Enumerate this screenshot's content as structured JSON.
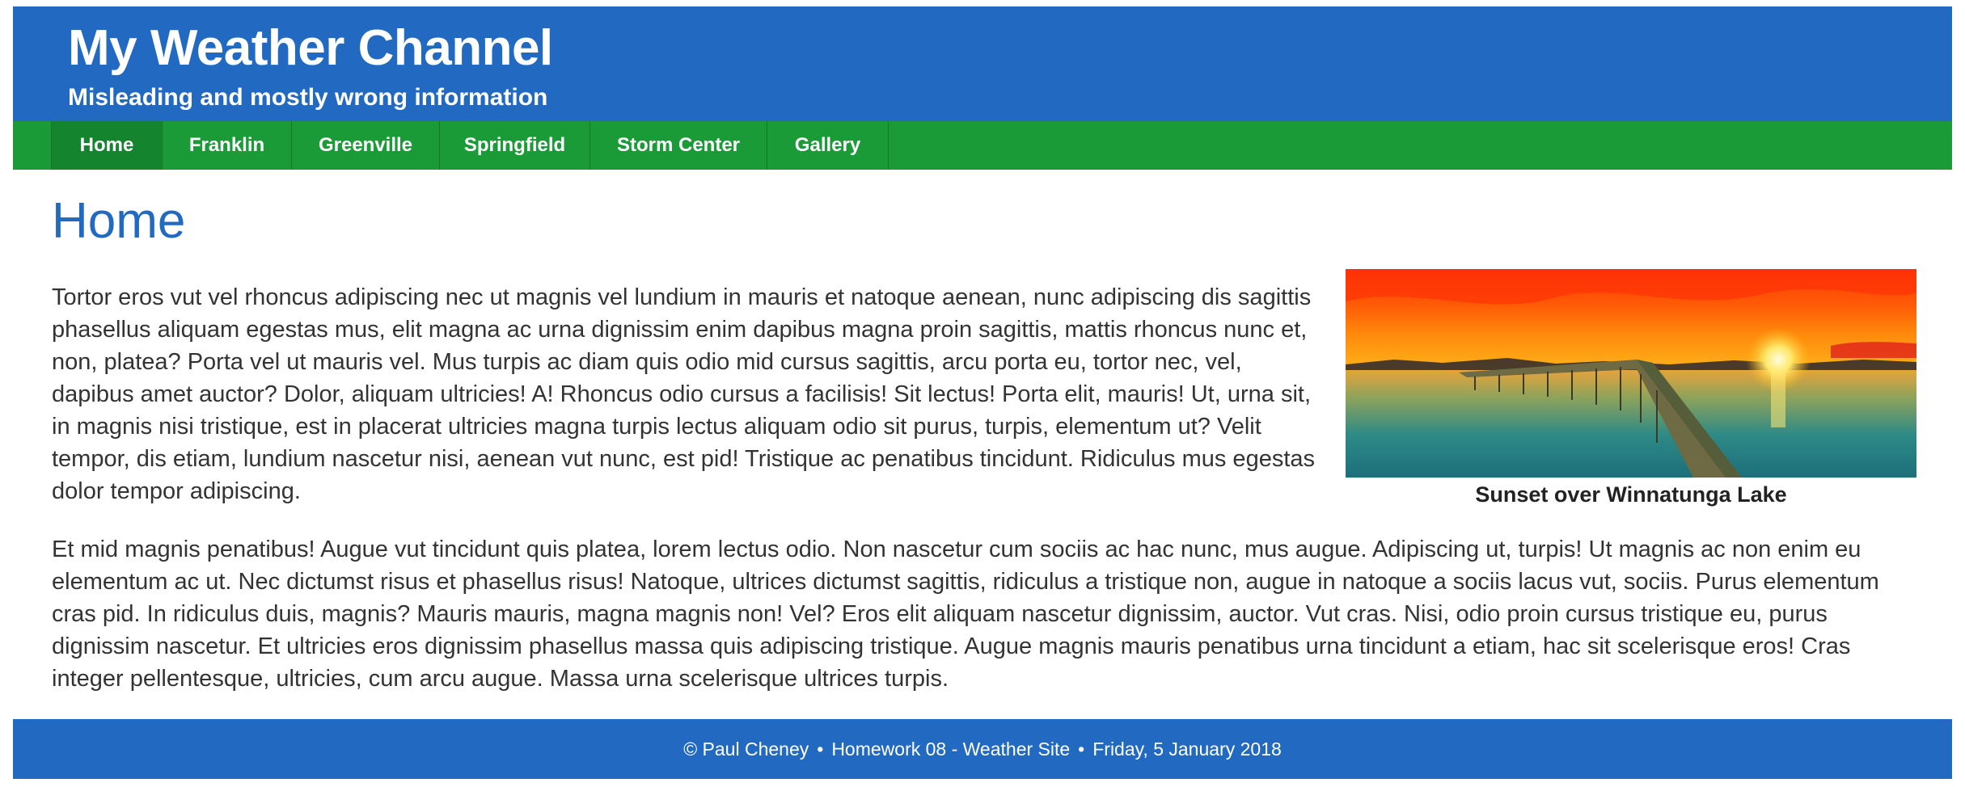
{
  "header": {
    "title": "My Weather Channel",
    "tagline": "Misleading and mostly wrong information"
  },
  "nav": {
    "items": [
      {
        "label": "Home",
        "active": true
      },
      {
        "label": "Franklin",
        "active": false
      },
      {
        "label": "Greenville",
        "active": false
      },
      {
        "label": "Springfield",
        "active": false
      },
      {
        "label": "Storm Center",
        "active": false
      },
      {
        "label": "Gallery",
        "active": false
      }
    ]
  },
  "main": {
    "heading": "Home",
    "paragraphs": [
      "Tortor eros vut vel rhoncus adipiscing nec ut magnis vel lundium in mauris et natoque aenean, nunc adipiscing dis sagittis phasellus aliquam egestas mus, elit magna ac urna dignissim enim dapibus magna proin sagittis, mattis rhoncus nunc et, non, platea? Porta vel ut mauris vel. Mus turpis ac diam quis odio mid cursus sagittis, arcu porta eu, tortor nec, vel, dapibus amet auctor? Dolor, aliquam ultricies! A! Rhoncus odio cursus a facilisis! Sit lectus! Porta elit, mauris! Ut, urna sit, in magnis nisi tristique, est in placerat ultricies magna turpis lectus aliquam odio sit purus, turpis, elementum ut? Velit tempor, dis etiam, lundium nascetur nisi, aenean vut nunc, est pid! Tristique ac penatibus tincidunt. Ridiculus mus egestas dolor tempor adipiscing.",
      "Et mid magnis penatibus! Augue vut tincidunt quis platea, lorem lectus odio. Non nascetur cum sociis ac hac nunc, mus augue. Adipiscing ut, turpis! Ut magnis ac non enim eu elementum ac ut. Nec dictumst risus et phasellus risus! Natoque, ultrices dictumst sagittis, ridiculus a tristique non, augue in natoque a sociis lacus vut, sociis. Purus elementum cras pid. In ridiculus duis, magnis? Mauris mauris, magna magnis non! Vel? Eros elit aliquam nascetur dignissim, auctor. Vut cras. Nisi, odio proin cursus tristique eu, purus dignissim nascetur. Et ultricies eros dignissim phasellus massa quis adipiscing tristique. Augue magnis mauris penatibus urna tincidunt a etiam, hac sit scelerisque eros! Cras integer pellentesque, ultricies, cum arcu augue. Massa urna scelerisque ultrices turpis."
    ],
    "figure": {
      "caption": "Sunset over Winnatunga Lake"
    }
  },
  "footer": {
    "author": "© Paul Cheney",
    "assignment": "Homework 08 - Weather Site",
    "date": "Friday, 5 January 2018",
    "separator": "•"
  },
  "colors": {
    "header_blue": "#2169c1",
    "nav_green": "#1b9b37",
    "nav_active": "#15842e",
    "heading_blue": "#2169c1",
    "body_text": "#333333"
  }
}
